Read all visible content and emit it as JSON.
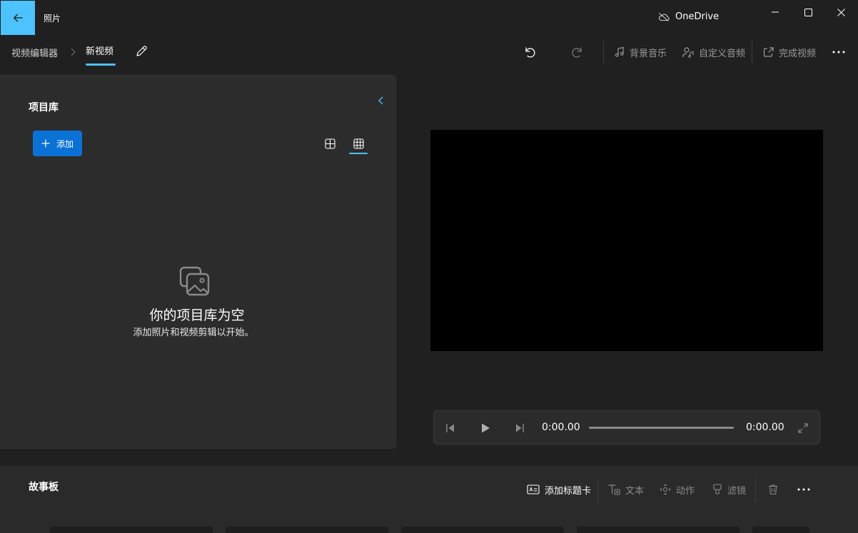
{
  "window": {
    "app_title": "照片",
    "onedrive_label": "OneDrive",
    "icons": {
      "back": "back-arrow-icon",
      "onedrive": "cloud-offline-icon",
      "minimize": "minimize-icon",
      "maximize": "maximize-icon",
      "close": "close-icon"
    }
  },
  "toolbar": {
    "breadcrumb_root": "视频编辑器",
    "breadcrumb_current": "新视频",
    "background_music_label": "背景音乐",
    "custom_audio_label": "自定义音频",
    "finish_video_label": "完成视频",
    "icons": [
      "chevron-right-icon",
      "pencil-icon",
      "undo-icon",
      "redo-icon",
      "music-note-icon",
      "person-music-icon",
      "share-icon",
      "more-icon"
    ]
  },
  "library": {
    "title": "项目库",
    "add_label": "添加",
    "empty_title": "你的项目库为空",
    "empty_subtitle": "添加照片和视频剪辑以开始。",
    "icons": [
      "chevron-left-icon",
      "plus-icon",
      "large-grid-icon",
      "small-grid-icon",
      "photos-icon"
    ]
  },
  "player": {
    "current_time": "0:00.00",
    "total_time": "0:00.00",
    "progress": 0,
    "icons": [
      "step-back-icon",
      "play-icon",
      "step-forward-icon",
      "fullscreen-icon"
    ]
  },
  "storyboard": {
    "title": "故事板",
    "add_title_card_label": "添加标题卡",
    "text_label": "文本",
    "motion_label": "动作",
    "filters_label": "滤镜",
    "icons": [
      "title-card-icon",
      "text-icon",
      "motion-icon",
      "filter-icon",
      "trash-icon",
      "more-icon"
    ]
  },
  "colors": {
    "accent": "#4cc2ff",
    "button_blue": "#0a72d6",
    "background": "#202020",
    "panel": "#2c2c2c",
    "disabled_text": "#9a9a9a"
  }
}
